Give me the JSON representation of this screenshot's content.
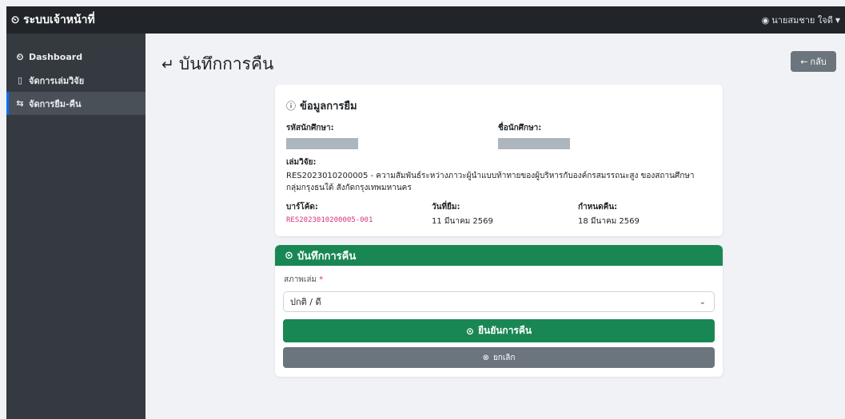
{
  "topbar": {
    "brand": "ระบบเจ้าหน้าที่",
    "brand_icon": "gauge-icon",
    "user": "นายสมชาย ใจดี"
  },
  "sidebar": {
    "items": [
      {
        "label": "Dashboard",
        "icon": "gauge-icon",
        "active": false
      },
      {
        "label": "จัดการเล่มวิจัย",
        "icon": "book-icon",
        "active": false
      },
      {
        "label": "จัดการยืม-คืน",
        "icon": "swap-icon",
        "active": true
      }
    ]
  },
  "page": {
    "title": "บันทึกการคืน",
    "back_label": "กลับ"
  },
  "loan_info": {
    "heading": "ข้อมูลการยืม",
    "student_id_label": "รหัสนักศึกษา:",
    "student_name_label": "ชื่อนักศึกษา:",
    "research_label": "เล่มวิจัย:",
    "research_value": "RES2023010200005 - ความสัมพันธ์ระหว่างภาวะผู้นำแบบท้าทายของผู้บริหารกับองค์กรสมรรถนะสูง ของสถานศึกษา กลุ่มกรุงธนใต้ สังกัดกรุงเทพมหานคร",
    "barcode_label": "บาร์โค้ด:",
    "barcode_value": "RES2023010200005-001",
    "borrow_date_label": "วันที่ยืม:",
    "borrow_date_value": "11 มีนาคม 2569",
    "due_date_label": "กำหนดคืน:",
    "due_date_value": "18 มีนาคม 2569"
  },
  "return_form": {
    "heading": "บันทึกการคืน",
    "condition_label": "สภาพเล่ม",
    "required_mark": "*",
    "condition_value": "ปกติ / ดี",
    "confirm_label": "ยืนยันการคืน",
    "cancel_label": "ยกเลิก"
  },
  "colors": {
    "success": "#198754",
    "secondary": "#6c757d",
    "dark": "#212529",
    "sidebar": "#343a40",
    "accent": "#0d6efd",
    "code": "#d63384"
  }
}
